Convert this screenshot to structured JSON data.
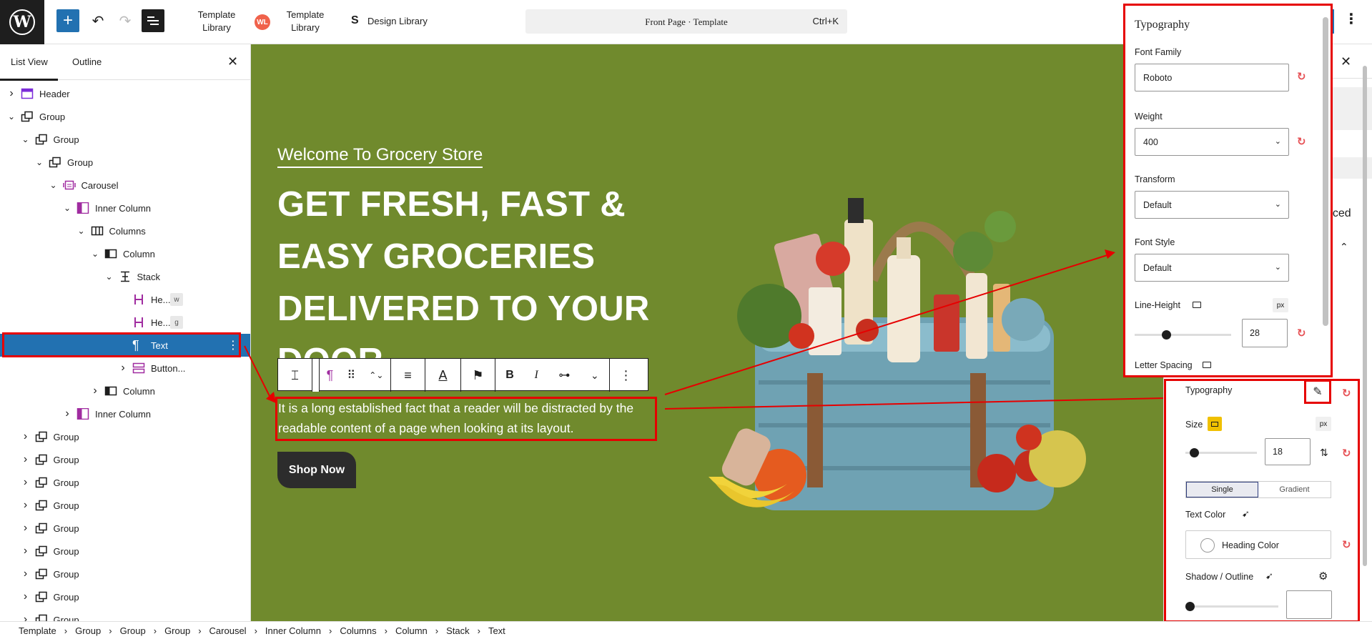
{
  "topbar": {
    "add_label": "+",
    "undo_label": "↶",
    "redo_label": "↷",
    "template_library_1": [
      "Template",
      "Library"
    ],
    "template_library_2": [
      "Template",
      "Library"
    ],
    "wl_badge": "WL",
    "design_library": "Design Library",
    "command_bar_title": "Front Page · Template",
    "command_bar_shortcut": "Ctrl+K",
    "options_label": "⋮"
  },
  "left_panel": {
    "tabs": [
      "List View",
      "Outline"
    ],
    "close_label": "✕",
    "rows": [
      {
        "label": "Header",
        "level": 0,
        "chev": "›",
        "icon": "header"
      },
      {
        "label": "Group",
        "level": 0,
        "chev": "⌄",
        "icon": "group"
      },
      {
        "label": "Group",
        "level": 1,
        "chev": "⌄",
        "icon": "group"
      },
      {
        "label": "Group",
        "level": 2,
        "chev": "⌄",
        "icon": "group"
      },
      {
        "label": "Carousel",
        "level": 3,
        "chev": "⌄",
        "icon": "carousel"
      },
      {
        "label": "Inner Column",
        "level": 4,
        "chev": "⌄",
        "icon": "innercol"
      },
      {
        "label": "Columns",
        "level": 5,
        "chev": "⌄",
        "icon": "columns"
      },
      {
        "label": "Column",
        "level": 6,
        "chev": "⌄",
        "icon": "column"
      },
      {
        "label": "Stack",
        "level": 7,
        "chev": "⌄",
        "icon": "stack"
      },
      {
        "label": "He...",
        "level": 8,
        "chev": "",
        "icon": "heading",
        "tag": "w"
      },
      {
        "label": "He...",
        "level": 8,
        "chev": "",
        "icon": "heading",
        "tag": "g"
      },
      {
        "label": "Text",
        "level": 8,
        "chev": "",
        "icon": "para",
        "selected": true
      },
      {
        "label": "Button...",
        "level": 8,
        "chev": "›",
        "icon": "button"
      },
      {
        "label": "Column",
        "level": 6,
        "chev": "›",
        "icon": "column"
      },
      {
        "label": "Inner Column",
        "level": 4,
        "chev": "›",
        "icon": "innercol"
      },
      {
        "label": "Group",
        "level": 1,
        "chev": "›",
        "icon": "group"
      },
      {
        "label": "Group",
        "level": 1,
        "chev": "›",
        "icon": "group"
      },
      {
        "label": "Group",
        "level": 1,
        "chev": "›",
        "icon": "group"
      },
      {
        "label": "Group",
        "level": 1,
        "chev": "›",
        "icon": "group"
      },
      {
        "label": "Group",
        "level": 1,
        "chev": "›",
        "icon": "group"
      },
      {
        "label": "Group",
        "level": 1,
        "chev": "›",
        "icon": "group"
      },
      {
        "label": "Group",
        "level": 1,
        "chev": "›",
        "icon": "group"
      },
      {
        "label": "Group",
        "level": 1,
        "chev": "›",
        "icon": "group"
      },
      {
        "label": "Group",
        "level": 1,
        "chev": "›",
        "icon": "group"
      }
    ],
    "selected_more": "⋮"
  },
  "canvas": {
    "welcome": "Welcome To Grocery Store",
    "heading": "GET FRESH, FAST & EASY GROCERIES DELIVERED TO YOUR DOOR",
    "paragraph": "It is a long established fact that a reader will be distracted by the readable content of a page when looking at its layout.",
    "shop_button": "Shop Now",
    "bg_color": "#708a2d"
  },
  "block_toolbar": {
    "parent": "⌶",
    "para": "¶",
    "drag": "⠿",
    "move": "⌃⌄",
    "align": "≡",
    "text_color": "A",
    "flag": "⚑",
    "bold": "B",
    "italic": "I",
    "link": "⊶",
    "more_chev": "⌄",
    "options": "⋮"
  },
  "typography_popup": {
    "title": "Typography",
    "font_family_label": "Font Family",
    "font_family_value": "Roboto",
    "weight_label": "Weight",
    "weight_value": "400",
    "transform_label": "Transform",
    "transform_value": "Default",
    "font_style_label": "Font Style",
    "font_style_value": "Default",
    "line_height_label": "Line-Height",
    "line_height_unit": "px",
    "line_height_value": "28",
    "line_height_fraction": 0.28,
    "letter_spacing_label": "Letter Spacing"
  },
  "typography_panel": {
    "typography_label": "Typography",
    "size_label": "Size",
    "size_unit": "px",
    "size_value": "18",
    "size_fraction": 0.06,
    "tab_single": "Single",
    "tab_gradient": "Gradient",
    "text_color_label": "Text Color",
    "heading_color_label": "Heading Color",
    "shadow_label": "Shadow / Outline"
  },
  "sidebar_partial": {
    "nced": "nced"
  },
  "breadcrumb": [
    "Template",
    "Group",
    "Group",
    "Group",
    "Carousel",
    "Inner Column",
    "Columns",
    "Column",
    "Stack",
    "Text"
  ]
}
